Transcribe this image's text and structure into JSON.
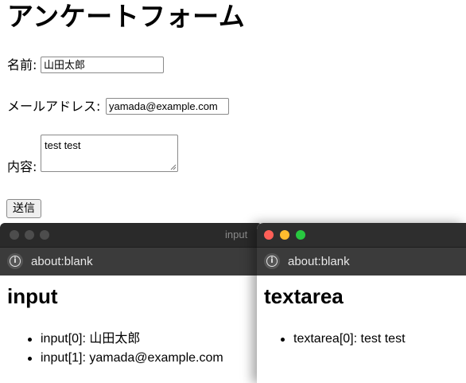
{
  "form": {
    "heading": "アンケートフォーム",
    "name_label": "名前:",
    "name_value": "山田太郎",
    "email_label": "メールアドレス:",
    "email_value": "yamada@example.com",
    "content_label": "内容:",
    "content_value": "test test",
    "submit_label": "送信"
  },
  "windows": [
    {
      "title": "input",
      "url": "about:blank",
      "heading": "input",
      "items": [
        "input[0]: 山田太郎",
        "input[1]: yamada@example.com"
      ]
    },
    {
      "title": "",
      "url": "about:blank",
      "heading": "textarea",
      "items": [
        "textarea[0]: test test"
      ]
    }
  ],
  "colors": {
    "close": "#fe5f57",
    "minimize": "#febc2e",
    "zoom": "#28c840",
    "titlebar": "#2c2c2c",
    "addressbar": "#3b3b3b"
  },
  "icons": [
    "info-icon",
    "resize-grip-icon"
  ]
}
